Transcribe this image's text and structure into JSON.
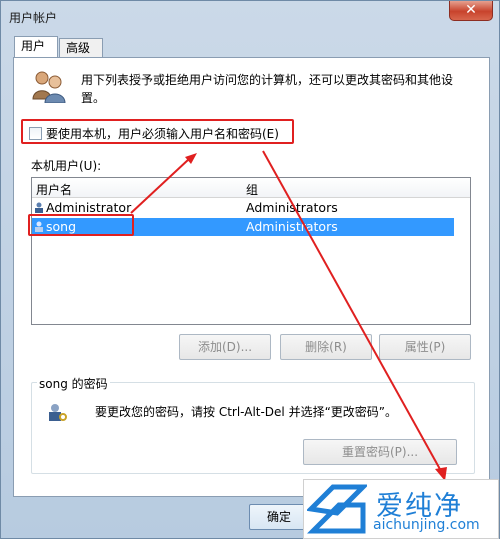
{
  "window": {
    "title": "用户帐户",
    "close_glyph": "✕"
  },
  "tabs": [
    {
      "label": "用户"
    },
    {
      "label": "高级"
    }
  ],
  "description": "用下列表授予或拒绝用户访问您的计算机，还可以更改其密码和其他设置。",
  "require_password": {
    "label": "要使用本机，用户必须输入用户名和密码(E)",
    "checked": false
  },
  "users_list": {
    "label": "本机用户(U):",
    "columns": [
      "用户名",
      "组"
    ],
    "rows": [
      {
        "name": "Administrator",
        "group": "Administrators",
        "selected": false
      },
      {
        "name": "song",
        "group": "Administrators",
        "selected": true
      }
    ]
  },
  "buttons": {
    "add": "添加(D)...",
    "remove": "删除(R)",
    "properties": "属性(P)",
    "reset_password": "重置密码(P)...",
    "ok": "确定"
  },
  "password_group": {
    "title": "song 的密码",
    "text": "要更改您的密码，请按 Ctrl-Alt-Del 并选择“更改密码”。"
  },
  "watermark": {
    "brand": "爱纯净",
    "url": "aichunjing.com"
  },
  "colors": {
    "highlight": "#e02020",
    "selection": "#3399ff",
    "brand": "#1f7fd6"
  }
}
